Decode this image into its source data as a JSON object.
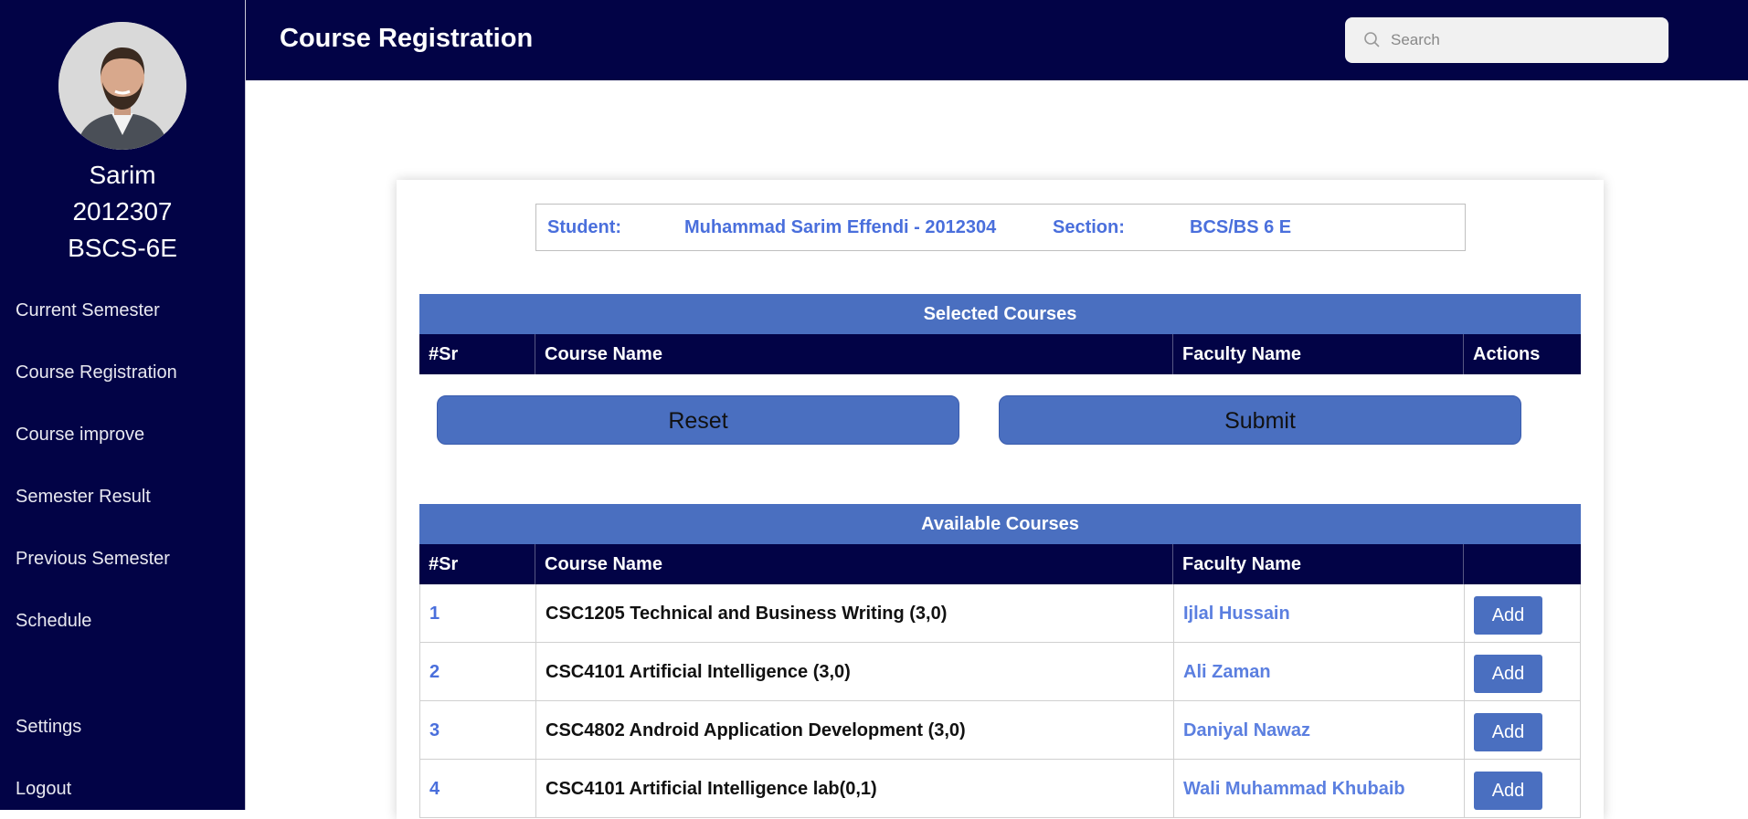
{
  "profile": {
    "name": "Sarim",
    "id": "2012307",
    "program": "BSCS-6E"
  },
  "sidebar": {
    "items": [
      {
        "label": "Current Semester"
      },
      {
        "label": "Course Registration"
      },
      {
        "label": "Course improve"
      },
      {
        "label": "Semester Result"
      },
      {
        "label": "Previous Semester"
      },
      {
        "label": "Schedule"
      }
    ],
    "settings_label": "Settings",
    "logout_label": "Logout"
  },
  "header": {
    "title": "Course Registration"
  },
  "search": {
    "placeholder": "Search"
  },
  "student_info": {
    "student_label": "Student:",
    "student_value": "Muhammad Sarim Effendi - 2012304",
    "section_label": "Section:",
    "section_value": "BCS/BS 6 E"
  },
  "selected_courses": {
    "title": "Selected Courses",
    "columns": [
      "#Sr",
      "Course Name",
      "Faculty Name",
      "Actions"
    ]
  },
  "buttons": {
    "reset": "Reset",
    "submit": "Submit"
  },
  "available_courses": {
    "title": "Available Courses",
    "columns": [
      "#Sr",
      "Course Name",
      "Faculty Name",
      ""
    ],
    "rows": [
      {
        "sr": "1",
        "course": "CSC1205 Technical and Business Writing (3,0)",
        "faculty": "Ijlal Hussain",
        "action": "Add"
      },
      {
        "sr": "2",
        "course": "CSC4101 Artificial Intelligence (3,0)",
        "faculty": "Ali Zaman",
        "action": "Add"
      },
      {
        "sr": "3",
        "course": "CSC4802 Android Application Development (3,0)",
        "faculty": "Daniyal Nawaz",
        "action": "Add"
      },
      {
        "sr": "4",
        "course": "CSC4101 Artificial Intelligence lab(0,1)",
        "faculty": "Wali Muhammad Khubaib",
        "action": "Add"
      }
    ]
  },
  "colors": {
    "navy": "#020346",
    "accent": "#4a6fc0",
    "link": "#4a6fdc"
  }
}
